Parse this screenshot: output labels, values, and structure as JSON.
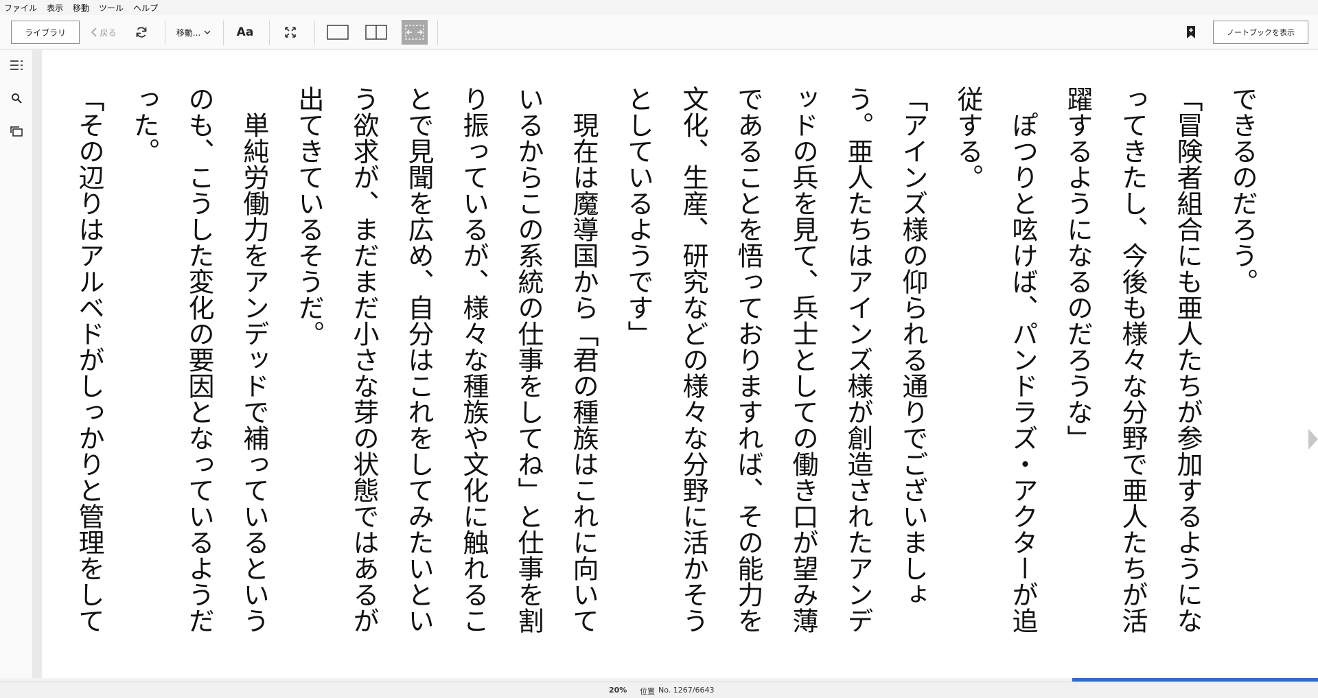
{
  "menu": [
    "ファイル",
    "表示",
    "移動",
    "ツール",
    "ヘルプ"
  ],
  "toolbar": {
    "library_label": "ライブラリ",
    "back_label": "戻る",
    "goto_label": "移動...",
    "font_label": "Aa",
    "notebook_label": "ノートブックを表示"
  },
  "sidebar": {
    "icons": [
      "table-of-contents-icon",
      "search-icon",
      "flashcards-icon"
    ]
  },
  "content": {
    "paragraphs": [
      {
        "text": "できるのだろう。",
        "indent": false
      },
      {
        "text": "「冒険者組合にも亜人たちが参加するようになってきたし、今後も様々な分野で亜人たちが活躍するようになるのだろうな」",
        "indent": false
      },
      {
        "text": "ぽつりと呟けば、パンドラズ・アクターが追従する。",
        "indent": true
      },
      {
        "text": "「アインズ様の仰られる通りでございましょう。亜人たちはアインズ様が創造されたアンデッドの兵を見て、兵士としての働き口が望み薄であることを悟っておりますれば、その能力を文化、生産、研究などの様々な分野に活かそうとしているようです」",
        "indent": false
      },
      {
        "text": "現在は魔導国から「君の種族はこれに向いているからこの系統の仕事をしてね」と仕事を割り振っているが、様々な種族や文化に触れることで見聞を広め、自分はこれをしてみたいという欲求が、まだまだ小さな芽の状態ではあるが出てきているそうだ。",
        "indent": true
      },
      {
        "text": "単純労働力をアンデッドで補っているというのも、こうした変化の要因となっているようだった。",
        "indent": true
      },
      {
        "text": "「その辺りはアルベドがしっかりと管理をして",
        "indent": false
      }
    ]
  },
  "status": {
    "percent": "20%",
    "location_label": "位置",
    "location": "No. 1267/6643",
    "progress": 0.2
  },
  "colors": {
    "progress": "#2a6fc9",
    "page_bg": "#ffffff"
  }
}
